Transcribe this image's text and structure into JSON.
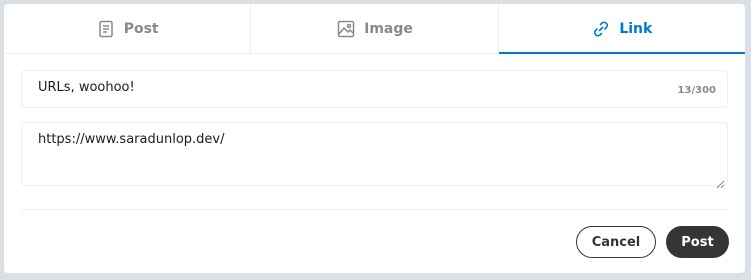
{
  "tabs": [
    {
      "label": "Post",
      "icon": "document-icon",
      "active": false
    },
    {
      "label": "Image",
      "icon": "image-icon",
      "active": false
    },
    {
      "label": "Link",
      "icon": "link-icon",
      "active": true
    }
  ],
  "title_field": {
    "value": "URLs, woohoo!",
    "char_count": "13/300"
  },
  "url_field": {
    "value": "https://www.saradunlop.dev/"
  },
  "actions": {
    "cancel_label": "Cancel",
    "post_label": "Post"
  },
  "colors": {
    "accent": "#0079d3",
    "muted": "#878a8c",
    "dark_button": "#343536",
    "background": "#dae0e6"
  }
}
